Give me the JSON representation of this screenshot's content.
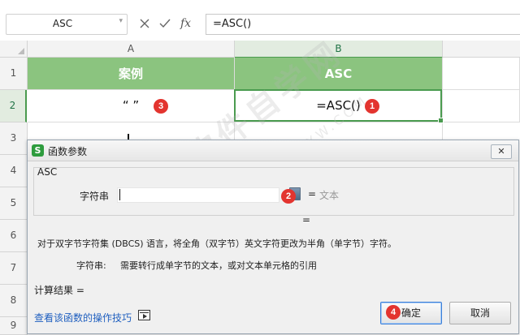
{
  "formula_bar": {
    "name_box": "ASC",
    "cancel_icon": "close-icon",
    "enter_icon": "check-icon",
    "fx_label": "fx",
    "formula": "=ASC()"
  },
  "grid": {
    "columns": [
      "A",
      "B"
    ],
    "rows": [
      "1",
      "2",
      "3",
      "4",
      "5",
      "6",
      "7",
      "8",
      "9"
    ],
    "cells": {
      "a1": "案例",
      "b1": "ASC",
      "a2": "“ ”",
      "b2": "=ASC()"
    },
    "header_fill": "#8bc47f",
    "selection_color": "#4a9b4f"
  },
  "badges": {
    "b1": "1",
    "b2": "2",
    "b3": "3",
    "b4": "4"
  },
  "dialog": {
    "title": "函数参数",
    "logo": "S",
    "close": "✕",
    "function_name": "ASC",
    "arg_label": "字符串",
    "arg_eq": "=",
    "arg_value": "文本",
    "result_eq": "=",
    "description": "对于双字节字符集 (DBCS) 语言，将全角（双字节）英文字符更改为半角（单字节）字符。",
    "arg_desc_label": "字符串:",
    "arg_desc_text": "需要转行成单字节的文本，或对文本单元格的引用",
    "calc_result": "计算结果 =",
    "tips_link": "查看该函数的操作技巧",
    "ok": "确定",
    "cancel": "取消"
  },
  "watermark": {
    "main": "软件自学网",
    "sub": "WWW.RJZXW.COM"
  }
}
